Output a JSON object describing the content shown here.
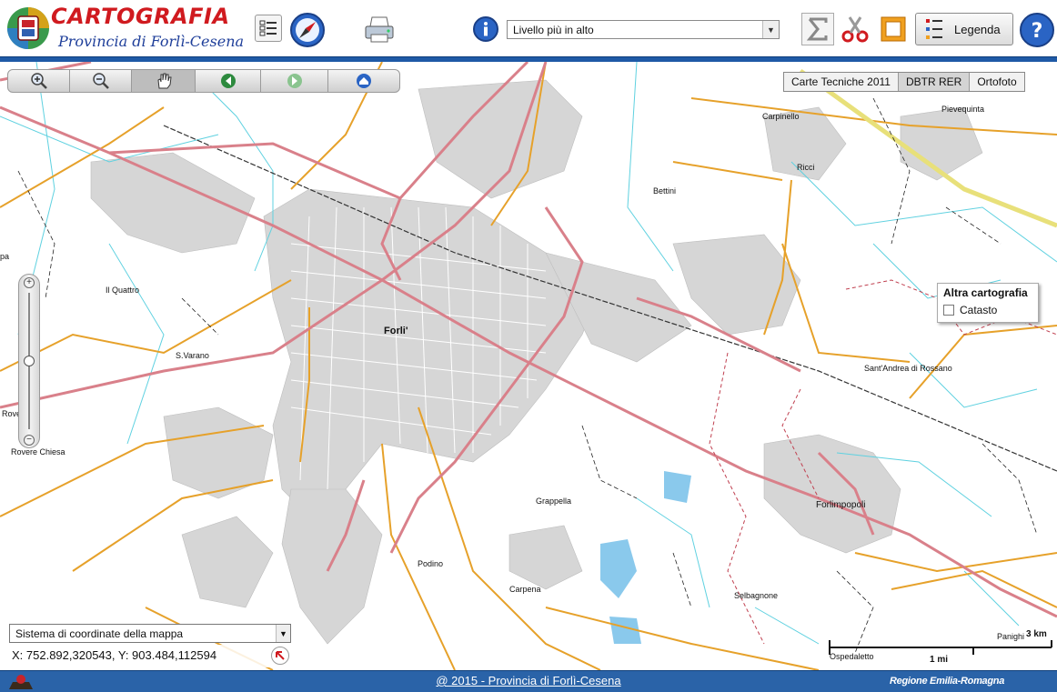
{
  "header": {
    "title": "CARTOGRAFIA",
    "subtitle": "Provincia di Forlì-Cesena",
    "level_select": {
      "value": "Livello più in alto"
    },
    "legend_label": "Legenda",
    "icons": {
      "layers": "layer-list-icon",
      "compass": "compass-icon",
      "print": "printer-icon",
      "info": "info-icon",
      "sum": "sigma-icon",
      "cut": "scissors-icon",
      "measure": "frame-icon",
      "legend": "legend-icon",
      "help": "help-icon"
    }
  },
  "map": {
    "nav_toolbar": {
      "buttons": [
        "zoom-in-icon",
        "zoom-out-icon",
        "pan-hand-icon",
        "back-icon",
        "forward-icon",
        "full-extent-icon"
      ]
    },
    "basemap_tabs": [
      {
        "label": "Carte Tecniche 2011",
        "active": false
      },
      {
        "label": "DBTR RER",
        "active": true
      },
      {
        "label": "Ortofoto",
        "active": false
      }
    ],
    "altra_cartografia": {
      "title": "Altra cartografia",
      "option": "Catasto",
      "checked": false
    },
    "place_names": {
      "carpinello": "Carpinello",
      "pievequinta": "Pievequinta",
      "ricci": "Ricci",
      "bettini": "Bettini",
      "quattro": "Il Quattro",
      "varano": "S.Varano",
      "roveri": "Roveri",
      "rovere_chiesa": "Rovere Chiesa",
      "pa": "pa",
      "forli": "Forli'",
      "santandrea": "Sant'Andrea di Rossano",
      "forlimpopoli": "Forlimpopoli",
      "grappella": "Grappella",
      "podino": "Podino",
      "carpena": "Carpena",
      "selbagnone": "Selbagnone",
      "ospedaletto": "Ospedaletto",
      "panighi": "Panighi"
    },
    "coords": {
      "system_label": "Sistema di coordinate della mappa",
      "readout": "X: 752.892,320543, Y: 903.484,112594"
    },
    "scale": {
      "km": "3 km",
      "mi": "1 mi"
    },
    "zoom_level": 0.5
  },
  "footer": {
    "link": "@ 2015 - Provincia di Forlì-Cesena",
    "logo_text": "Regione Emilia-Romagna"
  },
  "colors": {
    "header_rule": "#1f5aa6",
    "title_red": "#d01a1f",
    "subtitle_blue": "#1f3f9a",
    "road_major": "#d9808a",
    "road_secondary": "#e6a12a",
    "urban": "#d6d6d6",
    "water": "#5fd1e0"
  }
}
